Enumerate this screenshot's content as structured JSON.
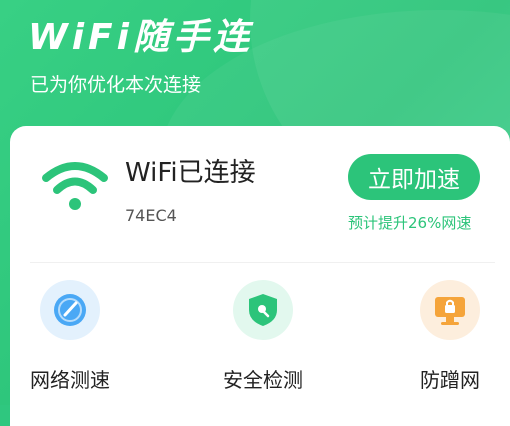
{
  "header": {
    "title": "WiFi随手连",
    "subtitle": "已为你优化本次连接"
  },
  "connection": {
    "status": "WiFi已连接",
    "ssid": "74EC4",
    "boost_button": "立即加速",
    "boost_estimate": "预计提升26%网速"
  },
  "tools": [
    {
      "label": "网络测速",
      "icon": "speedometer-icon",
      "color": "#4aa8f5",
      "bg": "#e3f1fd"
    },
    {
      "label": "安全检测",
      "icon": "shield-icon",
      "color": "#2cc47a",
      "bg": "#e2f8ee"
    },
    {
      "label": "防蹭网",
      "icon": "lock-monitor-icon",
      "color": "#f5a43a",
      "bg": "#fdeedd"
    }
  ],
  "colors": {
    "accent": "#2cc47a"
  }
}
